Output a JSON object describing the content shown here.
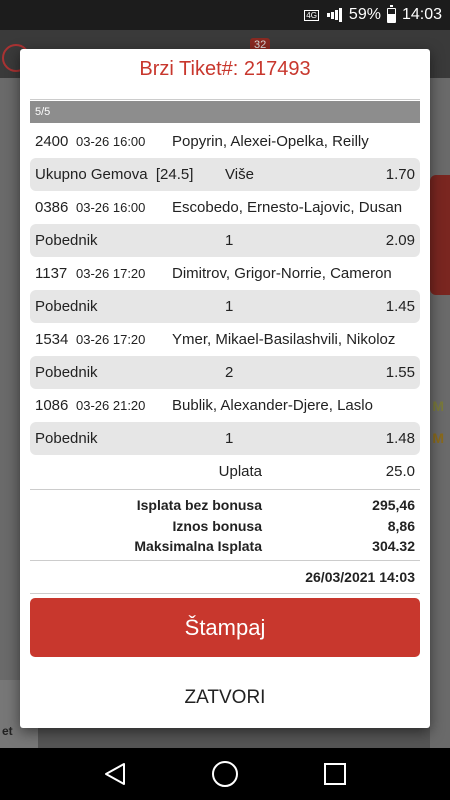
{
  "status_bar": {
    "network": "4G",
    "battery": "59%",
    "time": "14:03",
    "battery_level": 0.59
  },
  "background": {
    "badge": "32",
    "tab_label": "et",
    "mark_1": "M",
    "mark_2": "M"
  },
  "dialog": {
    "title": "Brzi Tiket#: 217493",
    "page": "5/5",
    "matches": [
      {
        "code": "2400",
        "time": "03-26 16:00",
        "teams": "Popyrin, Alexei-Opelka, Reilly",
        "bet_type": "Ukupno Gemova  [24.5]",
        "pick": "Više",
        "odd": "1.70"
      },
      {
        "code": "0386",
        "time": "03-26 16:00",
        "teams": "Escobedo, Ernesto-Lajovic, Dusan",
        "bet_type": "Pobednik",
        "pick": "1",
        "odd": "2.09"
      },
      {
        "code": "1137",
        "time": "03-26 17:20",
        "teams": "Dimitrov, Grigor-Norrie, Cameron",
        "bet_type": "Pobednik",
        "pick": "1",
        "odd": "1.45"
      },
      {
        "code": "1534",
        "time": "03-26 17:20",
        "teams": "Ymer, Mikael-Basilashvili, Nikoloz",
        "bet_type": "Pobednik",
        "pick": "2",
        "odd": "1.55"
      },
      {
        "code": "1086",
        "time": "03-26 21:20",
        "teams": "Bublik, Alexander-Djere, Laslo",
        "bet_type": "Pobednik",
        "pick": "1",
        "odd": "1.48"
      }
    ],
    "uplata_label": "Uplata",
    "uplata_value": "25.0",
    "summary": [
      {
        "label": "Isplata bez bonusa",
        "value": "295,46"
      },
      {
        "label": "Iznos bonusa",
        "value": "8,86"
      },
      {
        "label": "Maksimalna Isplata",
        "value": "304.32"
      }
    ],
    "datetime": "26/03/2021 14:03",
    "print_label": "Štampaj",
    "close_label": "ZATVORI"
  },
  "colors": {
    "accent": "#c8372d",
    "row_bg": "#e6e6e6",
    "page_bar": "#8d8d8d"
  },
  "icons": {
    "back": "back-triangle-icon",
    "home": "home-circle-icon",
    "recents": "recents-square-icon"
  }
}
